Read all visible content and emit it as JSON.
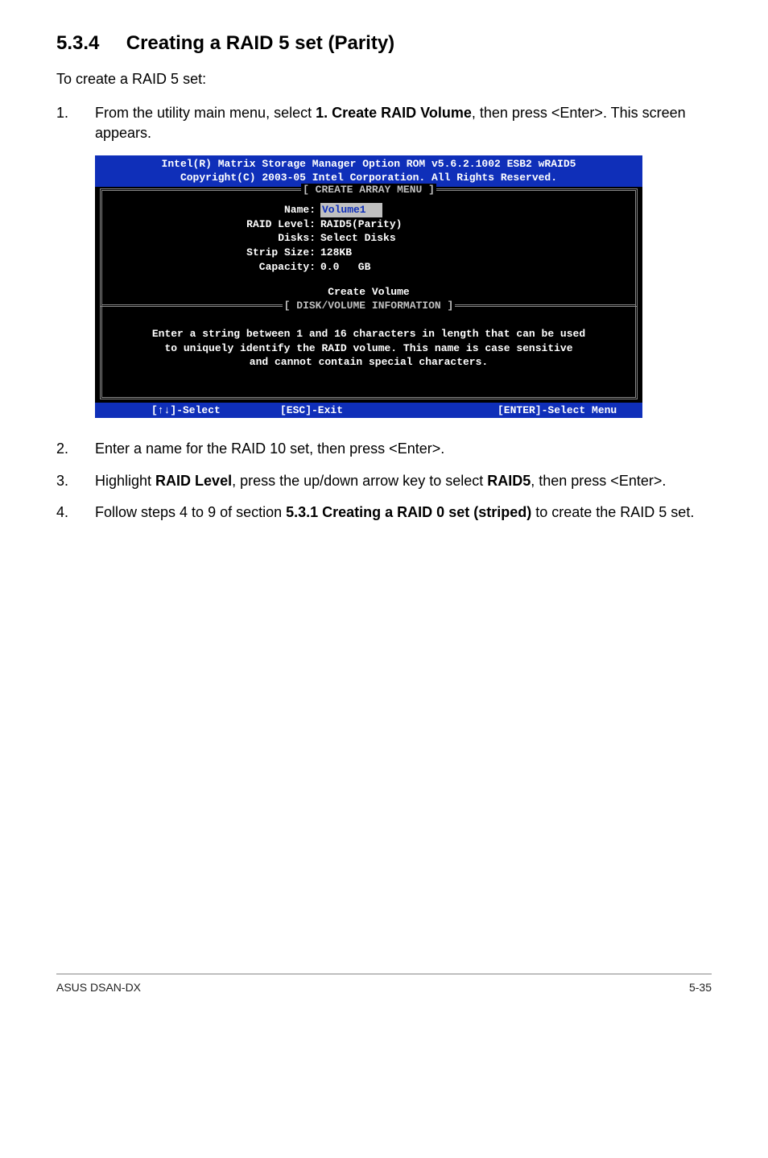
{
  "section": {
    "number": "5.3.4",
    "title": "Creating a RAID 5 set (Parity)"
  },
  "intro": "To create a RAID 5 set:",
  "steps": [
    {
      "num": "1.",
      "parts": [
        {
          "t": "From the utility main menu, select "
        },
        {
          "t": "1. Create RAID Volume",
          "b": true
        },
        {
          "t": ", then press <Enter>. This screen appears."
        }
      ]
    },
    {
      "num": "2.",
      "parts": [
        {
          "t": "Enter a name for the RAID 10 set, then press <Enter>."
        }
      ]
    },
    {
      "num": "3.",
      "parts": [
        {
          "t": "Highlight "
        },
        {
          "t": "RAID Level",
          "b": true
        },
        {
          "t": ", press the up/down arrow key to select "
        },
        {
          "t": "RAID5",
          "b": true
        },
        {
          "t": ", then press <Enter>."
        }
      ]
    },
    {
      "num": "4.",
      "parts": [
        {
          "t": "Follow steps 4 to 9 of section "
        },
        {
          "t": "5.3.1 Creating a RAID 0 set (striped)",
          "b": true
        },
        {
          "t": " to create the RAID 5 set."
        }
      ]
    }
  ],
  "terminal": {
    "header_line1": "Intel(R) Matrix Storage Manager Option ROM v5.6.2.1002 ESB2 wRAID5",
    "header_line2": "Copyright(C) 2003-05 Intel Corporation. All Rights Reserved.",
    "menu_legend": "[ CREATE ARRAY MENU ]",
    "fields": {
      "name_label": "Name:",
      "name_value": "Volume1",
      "raid_level_label": "RAID Level:",
      "raid_level_value": "RAID5(Parity)",
      "disks_label": "Disks:",
      "disks_value": "Select Disks",
      "strip_label": "Strip Size:",
      "strip_value": "128KB",
      "capacity_label": "Capacity:",
      "capacity_value": "0.0   GB"
    },
    "create_volume": "Create Volume",
    "info_legend": "[ DISK/VOLUME INFORMATION ]",
    "info_line1": "Enter a string between 1 and 16 characters in length that can be used",
    "info_line2": "to uniquely identify the RAID volume. This name is case sensitive",
    "info_line3": "and cannot contain special characters.",
    "footer": {
      "select": "[↑↓]-Select",
      "exit": "[ESC]-Exit",
      "enter": "[ENTER]-Select Menu"
    }
  },
  "footer": {
    "left": "ASUS DSAN-DX",
    "right": "5-35"
  }
}
